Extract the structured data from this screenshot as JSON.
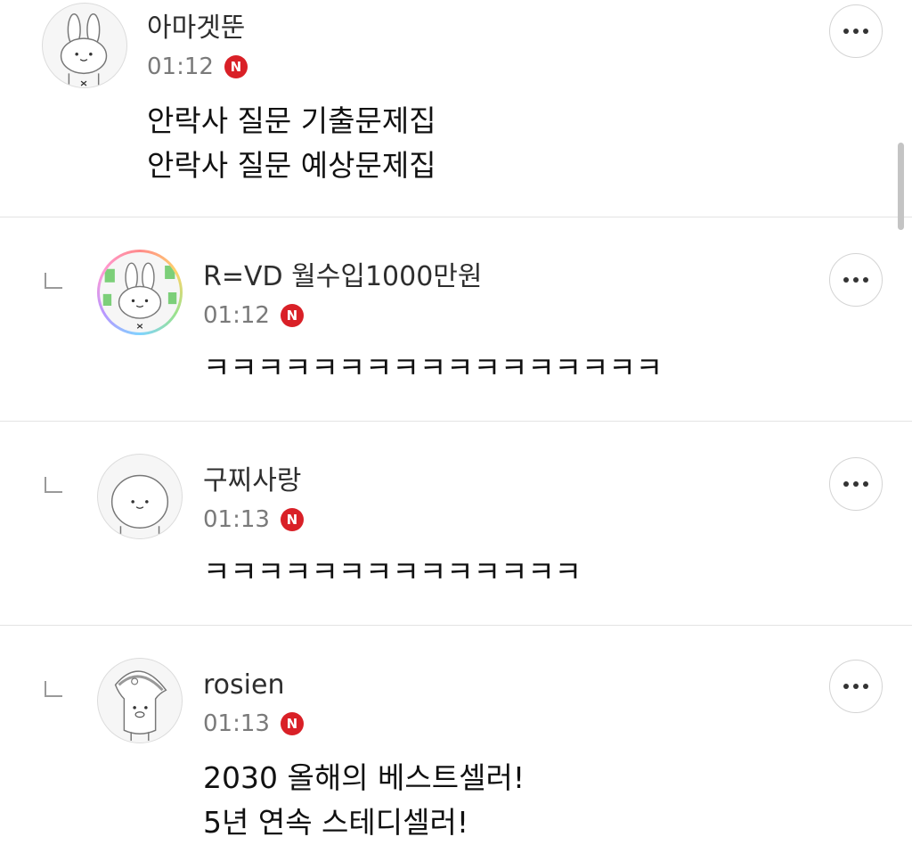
{
  "comments": [
    {
      "nickname": "아마겟뚠",
      "time": "01:12",
      "badge": "N",
      "is_reply": false,
      "lines": [
        "안락사 질문 기출문제집",
        "안락사 질문 예상문제집"
      ]
    },
    {
      "nickname": "R=VD 월수입1000만원",
      "time": "01:12",
      "badge": "N",
      "is_reply": true,
      "lines": [
        "ㅋㅋㅋㅋㅋㅋㅋㅋㅋㅋㅋㅋㅋㅋㅋㅋㅋ"
      ]
    },
    {
      "nickname": "구찌사랑",
      "time": "01:13",
      "badge": "N",
      "is_reply": true,
      "lines": [
        "ㅋㅋㅋㅋㅋㅋㅋㅋㅋㅋㅋㅋㅋㅋ"
      ]
    },
    {
      "nickname": "rosien",
      "time": "01:13",
      "badge": "N",
      "is_reply": true,
      "lines": [
        "2030 올해의 베스트셀러!",
        "5년 연속 스테디셀러!"
      ]
    }
  ],
  "icons": {
    "more": "more-horizontal-icon",
    "reply": "reply-arrow-icon",
    "badge": "new-badge-icon"
  },
  "colors": {
    "badge_red": "#d92027",
    "time_gray": "#7a7a7a",
    "divider": "#e3e3e3"
  }
}
